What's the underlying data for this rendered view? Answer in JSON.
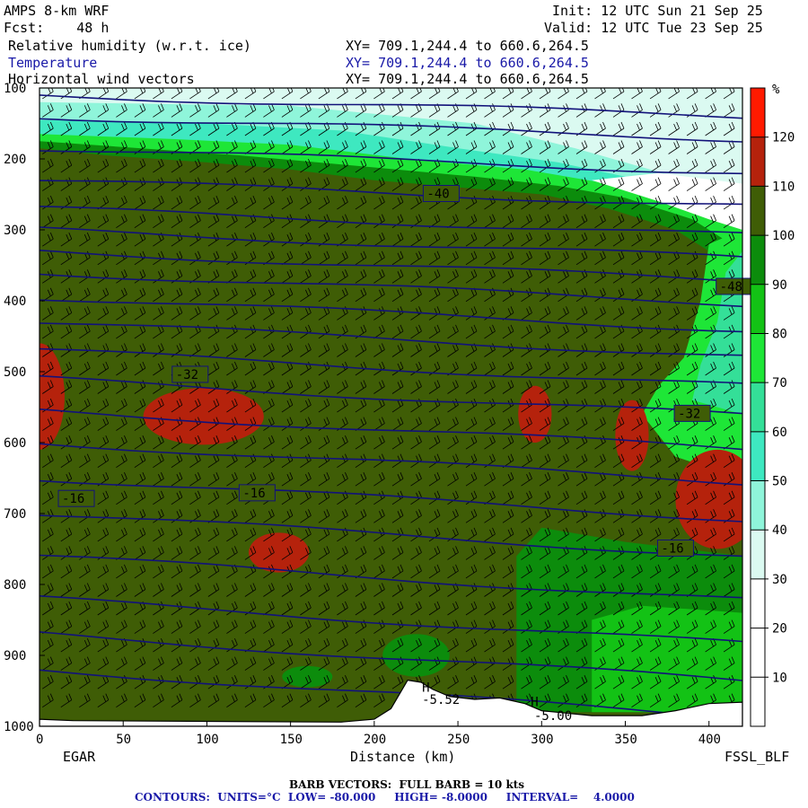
{
  "header": {
    "model": "AMPS 8-km WRF",
    "forecast": "Fcst:    48 h",
    "init": "Init: 12 UTC Sun 21 Sep 25",
    "valid": "Valid: 12 UTC Tue 23 Sep 25",
    "fields": [
      {
        "name": "Relative humidity (w.r.t. ice)",
        "xy": "XY= 709.1,244.4 to 660.6,264.5"
      },
      {
        "name": "Temperature",
        "xy": "XY= 709.1,244.4 to 660.6,264.5"
      },
      {
        "name": "Horizontal wind vectors",
        "xy": "XY= 709.1,244.4 to 660.6,264.5"
      }
    ]
  },
  "footer": {
    "barb": "BARB VECTORS:  FULL BARB = 10 kts",
    "contours": "CONTOURS:  UNITS=°C  LOW= -80.000     HIGH= -8.0000     INTERVAL=    4.0000"
  },
  "chart_data": {
    "type": "heatmap",
    "title": "Relative humidity (w.r.t. ice)",
    "xlabel": "Distance (km)",
    "ylabel": "",
    "x_left_label": "EGAR",
    "x_right_label": "FSSL_BLF",
    "xlim": [
      0,
      420
    ],
    "ylim": [
      1000,
      100
    ],
    "x_ticks": [
      0,
      50,
      100,
      150,
      200,
      250,
      300,
      350,
      400
    ],
    "y_ticks": [
      100,
      200,
      300,
      400,
      500,
      600,
      700,
      800,
      900,
      1000
    ],
    "colorbar": {
      "unit": "%",
      "levels": [
        10,
        20,
        30,
        40,
        50,
        60,
        70,
        80,
        90,
        100,
        110,
        120
      ],
      "colors": [
        "#ffffff",
        "#ffffff",
        "#ffffff",
        "#dbfaf1",
        "#8ff5da",
        "#3ee8c0",
        "#34df98",
        "#1ee637",
        "#13c215",
        "#0c8c0c",
        "#3f5d06",
        "#b5220c",
        "#ff1a00"
      ]
    },
    "temperature_contours": {
      "units": "°C",
      "low": -80,
      "high": -8,
      "interval": 4,
      "labels": [
        {
          "text": "-48",
          "x": 415,
          "p": 381
        },
        {
          "text": "-40",
          "x": 240,
          "p": 250
        },
        {
          "text": "-32",
          "x": 90,
          "p": 505
        },
        {
          "text": "-32",
          "x": 390,
          "p": 560
        },
        {
          "text": "-16",
          "x": 22,
          "p": 680
        },
        {
          "text": "-16",
          "x": 130,
          "p": 672
        },
        {
          "text": "-16",
          "x": 380,
          "p": 750
        }
      ]
    },
    "pressure_labels": [
      {
        "text": "H",
        "x": 235,
        "p": 945
      },
      {
        "text": "-5.52",
        "x": 235,
        "p": 962
      },
      {
        "text": "H",
        "x": 300,
        "p": 965
      },
      {
        "text": "-5.00",
        "x": 302,
        "p": 985
      }
    ],
    "terrain_p": [
      [
        0,
        990
      ],
      [
        20,
        992
      ],
      [
        100,
        993
      ],
      [
        180,
        994
      ],
      [
        200,
        990
      ],
      [
        210,
        975
      ],
      [
        215,
        955
      ],
      [
        220,
        935
      ],
      [
        228,
        938
      ],
      [
        235,
        948
      ],
      [
        245,
        958
      ],
      [
        260,
        962
      ],
      [
        275,
        960
      ],
      [
        290,
        968
      ],
      [
        300,
        978
      ],
      [
        330,
        985
      ],
      [
        360,
        985
      ],
      [
        380,
        978
      ],
      [
        400,
        968
      ],
      [
        420,
        966
      ]
    ],
    "rh_regions": [
      {
        "color": "#b5220c",
        "kind": "ellipse",
        "x": 0,
        "p": 535,
        "rx": 15,
        "rp": 75
      },
      {
        "color": "#b5220c",
        "kind": "ellipse",
        "x": 98,
        "p": 563,
        "rx": 36,
        "rp": 40
      },
      {
        "color": "#b5220c",
        "kind": "ellipse",
        "x": 143,
        "p": 755,
        "rx": 18,
        "rp": 28
      },
      {
        "color": "#b5220c",
        "kind": "ellipse",
        "x": 296,
        "p": 560,
        "rx": 10,
        "rp": 40
      },
      {
        "color": "#b5220c",
        "kind": "ellipse",
        "x": 354,
        "p": 590,
        "rx": 10,
        "rp": 50
      },
      {
        "color": "#b5220c",
        "kind": "ellipse",
        "x": 405,
        "p": 680,
        "rx": 25,
        "rp": 70
      }
    ]
  }
}
